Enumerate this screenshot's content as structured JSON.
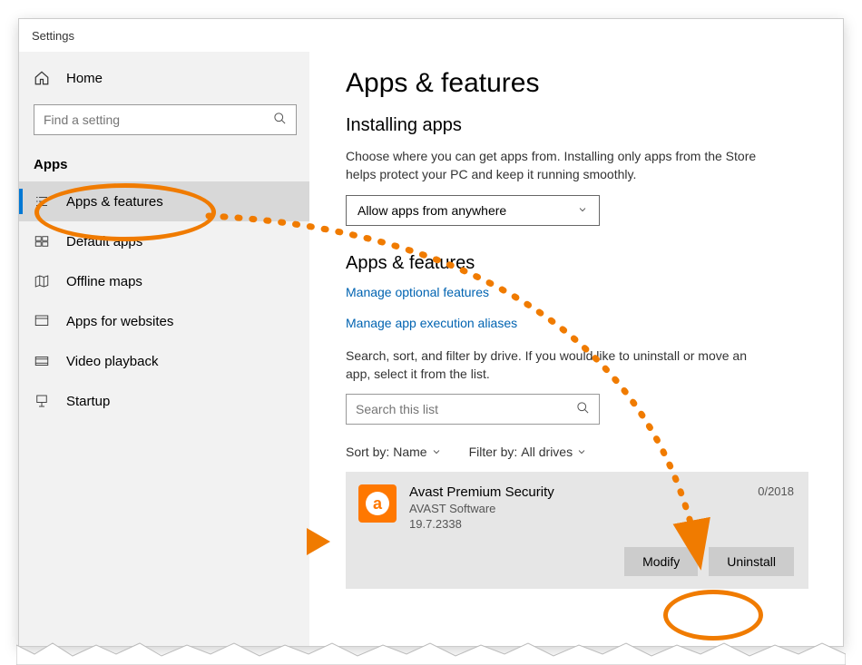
{
  "titlebar": "Settings",
  "sidebar": {
    "home": "Home",
    "search_placeholder": "Find a setting",
    "section": "Apps",
    "items": [
      {
        "label": "Apps & features"
      },
      {
        "label": "Default apps"
      },
      {
        "label": "Offline maps"
      },
      {
        "label": "Apps for websites"
      },
      {
        "label": "Video playback"
      },
      {
        "label": "Startup"
      }
    ]
  },
  "main": {
    "title": "Apps & features",
    "installing_header": "Installing apps",
    "installing_desc": "Choose where you can get apps from. Installing only apps from the Store helps protect your PC and keep it running smoothly.",
    "installing_dropdown": "Allow apps from anywhere",
    "apps_header": "Apps & features",
    "link1": "Manage optional features",
    "link2": "Manage app execution aliases",
    "list_desc": "Search, sort, and filter by drive. If you would like to uninstall or move an app, select it from the list.",
    "list_search_placeholder": "Search this list",
    "sort_label": "Sort by:",
    "sort_value": "Name",
    "filter_label": "Filter by:",
    "filter_value": "All drives",
    "app": {
      "name": "Avast Premium Security",
      "publisher": "AVAST Software",
      "version": "19.7.2338",
      "date": "0/2018",
      "modify": "Modify",
      "uninstall": "Uninstall"
    }
  }
}
